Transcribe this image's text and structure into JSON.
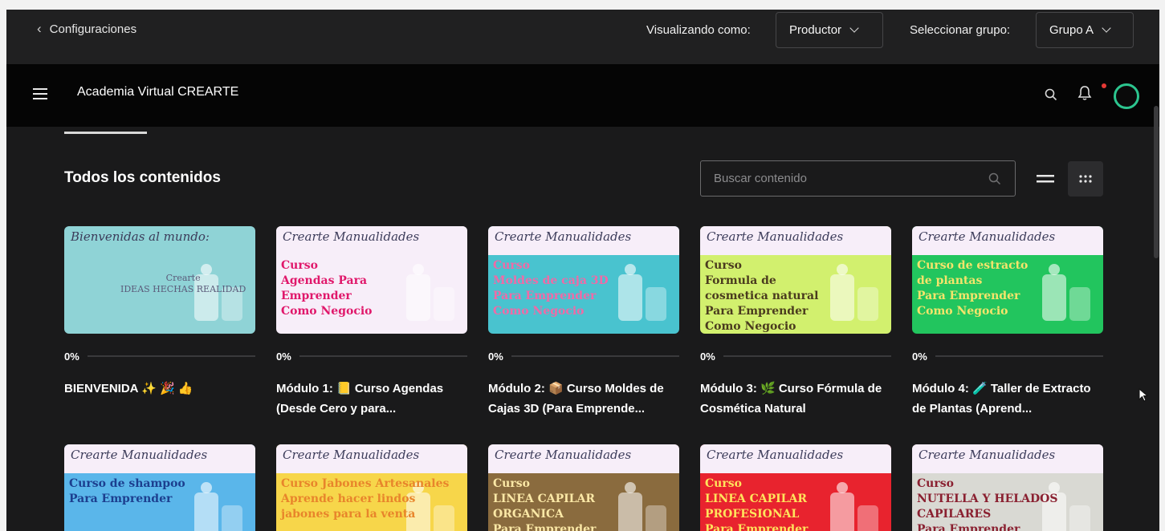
{
  "adminbar": {
    "back_label": "Configuraciones",
    "viewing_label": "Visualizando como:",
    "role_value": "Productor",
    "group_label": "Seleccionar grupo:",
    "group_value": "Grupo A"
  },
  "header": {
    "brand": "Academia Virtual CREARTE"
  },
  "content": {
    "title": "Todos los contenidos",
    "search_placeholder": "Buscar contenido"
  },
  "cards": [
    {
      "pct": "0%",
      "title": "BIENVENIDA ✨ 🎉 👍",
      "banner": "Bienvenidas al mundo:",
      "thumb_lines": [
        "Crearte",
        "IDEAS HECHAS REALIDAD"
      ],
      "color": "#8fd3d6",
      "text_color": "#5b5b7a",
      "icon": "butterfly-icon"
    },
    {
      "pct": "0%",
      "title": "Módulo 1: 📒 Curso Agendas (Desde Cero y para...",
      "banner": "Crearte Manualidades",
      "thumb_lines": [
        "Curso",
        "Agendas Para",
        "Emprender",
        "Como Negocio"
      ],
      "color": "#f7eef9",
      "text_color": "#e0186b",
      "icon": "calendar-icon"
    },
    {
      "pct": "0%",
      "title": "Módulo 2: 📦 Curso Moldes de Cajas 3D (Para Emprende...",
      "banner": "Crearte Manualidades",
      "thumb_lines": [
        "Curso",
        "Moldes de caja 3D",
        "Para Emprender",
        "Como Negocio"
      ],
      "color": "#49c3cf",
      "text_color": "#f06aa6",
      "icon": "gift-icon"
    },
    {
      "pct": "0%",
      "title": "Módulo 3: 🌿 Curso Fórmula de Cosmética Natural",
      "banner": "Crearte Manualidades",
      "thumb_lines": [
        "Curso",
        "Formula de",
        "cosmetica natural",
        "Para Emprender",
        "Como Negocio"
      ],
      "color": "#d2f06e",
      "text_color": "#4a3b1e",
      "icon": "cosmetics-icon"
    },
    {
      "pct": "0%",
      "title": "Módulo 4: 🧪 Taller de Extracto de Plantas (Aprend...",
      "banner": "Crearte Manualidades",
      "thumb_lines": [
        "Curso de estracto",
        "de plantas",
        "Para Emprender",
        "Como Negocio"
      ],
      "color": "#22c55e",
      "text_color": "#f5e46b",
      "icon": "flask-icon"
    },
    {
      "pct": "",
      "title": "",
      "banner": "Crearte Manualidades",
      "thumb_lines": [
        "Curso de shampoo",
        "Para Emprender"
      ],
      "color": "#5ab6ea",
      "text_color": "#1c3f8f",
      "icon": "bottle-icon"
    },
    {
      "pct": "",
      "title": "",
      "banner": "Crearte Manualidades",
      "thumb_lines": [
        "Curso Jabones Artesanales",
        "Aprende hacer lindos",
        "jabones para la venta"
      ],
      "color": "#f7d64a",
      "text_color": "#e8852b",
      "icon": "soap-icon"
    },
    {
      "pct": "",
      "title": "",
      "banner": "Crearte Manualidades",
      "thumb_lines": [
        "Curso",
        "LINEA CAPILAR",
        "ORGANICA",
        "Para Emprender"
      ],
      "color": "#8a6b3e",
      "text_color": "#fbe8a6",
      "icon": "bottle-icon"
    },
    {
      "pct": "",
      "title": "",
      "banner": "Crearte Manualidades",
      "thumb_lines": [
        "Curso",
        "LINEA CAPILAR",
        "PROFESIONAL",
        "Para Emprender"
      ],
      "color": "#e8232e",
      "text_color": "#ffe45c",
      "icon": "bottle-icon"
    },
    {
      "pct": "",
      "title": "",
      "banner": "Crearte Manualidades",
      "thumb_lines": [
        "Curso",
        "NUTELLA Y HELADOS",
        "CAPILARES",
        "Para Emprender"
      ],
      "color": "#d9d9d3",
      "text_color": "#8a2030",
      "icon": "jar-icon"
    }
  ]
}
